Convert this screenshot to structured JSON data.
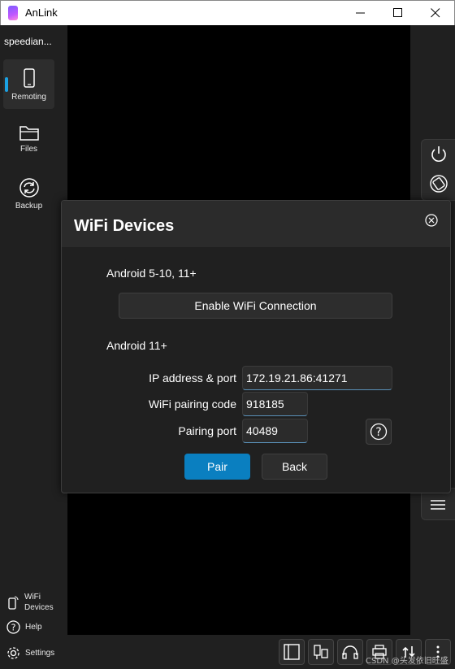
{
  "window": {
    "title": "AnLink",
    "controls": [
      "minimize-icon",
      "maximize-icon",
      "close-icon"
    ]
  },
  "sidebar": {
    "device_name": "speedian...",
    "items": [
      {
        "label": "Remoting",
        "icon": "phone-icon",
        "active": true
      },
      {
        "label": "Files",
        "icon": "folder-icon",
        "active": false
      },
      {
        "label": "Backup",
        "icon": "sync-icon",
        "active": false
      }
    ],
    "bottom_items": [
      {
        "label_line1": "WiFi",
        "label_line2": "Devices",
        "icon": "phone-wifi-icon"
      },
      {
        "label": "Help",
        "icon": "help-icon"
      },
      {
        "label": "Settings",
        "icon": "gear-icon"
      }
    ]
  },
  "right_toolbar": {
    "top_icons": [
      "power-icon",
      "rotate-icon"
    ],
    "bottom_icons": [
      "menu-icon"
    ]
  },
  "bottom_toolbar": {
    "icons": [
      "window-icon",
      "usb-icon",
      "headphones-icon",
      "printer-icon",
      "transfer-icon",
      "more-icon"
    ]
  },
  "watermark": "CSDN @头发依旧旺盛",
  "dialog": {
    "title": "WiFi Devices",
    "section1": "Android 5-10, 11+",
    "enable_button": "Enable WiFi Connection",
    "section2": "Android 11+",
    "fields": {
      "ip_label": "IP address & port",
      "ip_value": "172.19.21.86:41271",
      "code_label": "WiFi pairing code",
      "code_value": "918185",
      "port_label": "Pairing port",
      "port_value": "40489"
    },
    "pair_button": "Pair",
    "back_button": "Back"
  },
  "colors": {
    "accent": "#0a7fc0",
    "indicator": "#1ba1e2",
    "background": "#202020"
  }
}
